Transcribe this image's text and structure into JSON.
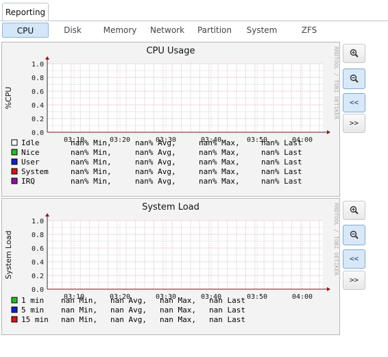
{
  "main_tab": "Reporting",
  "subtabs": [
    {
      "label": "CPU",
      "active": true
    },
    {
      "label": "Disk",
      "active": false
    },
    {
      "label": "Memory",
      "active": false
    },
    {
      "label": "Network",
      "active": false
    },
    {
      "label": "Partition",
      "active": false
    },
    {
      "label": "System",
      "active": false
    },
    {
      "label": "ZFS",
      "active": false
    }
  ],
  "watermark": "RRDTOOL / TOBI OETIKER",
  "buttons": {
    "zoom_in": "zoom-in",
    "zoom_out": "zoom-out",
    "back": "<<",
    "forward": ">>"
  },
  "graphs": [
    {
      "title": "CPU Usage",
      "ylabel": "%CPU",
      "y_ticks": [
        "1.0",
        "0.8",
        "0.6",
        "0.4",
        "0.2",
        "0.0"
      ],
      "x_ticks": [
        "03:10",
        "03:20",
        "03:30",
        "03:40",
        "03:50",
        "04:00"
      ],
      "legend": [
        {
          "name": "Idle",
          "color": "#ffffff",
          "min": "nan% Min,",
          "avg": "nan% Avg,",
          "max": "nan% Max,",
          "last": "nan% Last"
        },
        {
          "name": "Nice",
          "color": "#20c020",
          "min": "nan% Min,",
          "avg": "nan% Avg,",
          "max": "nan% Max,",
          "last": "nan% Last"
        },
        {
          "name": "User",
          "color": "#1020d0",
          "min": "nan% Min,",
          "avg": "nan% Avg,",
          "max": "nan% Max,",
          "last": "nan% Last"
        },
        {
          "name": "System",
          "color": "#e01010",
          "min": "nan% Min,",
          "avg": "nan% Avg,",
          "max": "nan% Max,",
          "last": "nan% Last"
        },
        {
          "name": "IRQ",
          "color": "#9010a0",
          "min": "nan% Min,",
          "avg": "nan% Avg,",
          "max": "nan% Max,",
          "last": "nan% Last"
        }
      ]
    },
    {
      "title": "System Load",
      "ylabel": "System Load",
      "y_ticks": [
        "1.0",
        "0.8",
        "0.6",
        "0.4",
        "0.2",
        "0.0"
      ],
      "x_ticks": [
        "03:10",
        "03:20",
        "03:30",
        "03:40",
        "03:50",
        "04:00"
      ],
      "legend": [
        {
          "name": " 1 min",
          "color": "#20c020",
          "min": "nan Min,",
          "avg": "nan Avg,",
          "max": "nan Max,",
          "last": "nan Last"
        },
        {
          "name": " 5 min",
          "color": "#1020d0",
          "min": "nan Min,",
          "avg": "nan Avg,",
          "max": "nan Max,",
          "last": "nan Last"
        },
        {
          "name": "15 min",
          "color": "#e01010",
          "min": "nan Min,",
          "avg": "nan Avg,",
          "max": "nan Max,",
          "last": "nan Last"
        }
      ]
    }
  ],
  "chart_data": [
    {
      "type": "line",
      "title": "CPU Usage",
      "ylabel": "%CPU",
      "xlabel": "",
      "ylim": [
        0,
        1.0
      ],
      "x": [
        "03:10",
        "03:20",
        "03:30",
        "03:40",
        "03:50",
        "04:00"
      ],
      "series": [
        {
          "name": "Idle",
          "values": []
        },
        {
          "name": "Nice",
          "values": []
        },
        {
          "name": "User",
          "values": []
        },
        {
          "name": "System",
          "values": []
        },
        {
          "name": "IRQ",
          "values": []
        }
      ],
      "grid": true
    },
    {
      "type": "line",
      "title": "System Load",
      "ylabel": "System Load",
      "xlabel": "",
      "ylim": [
        0,
        1.0
      ],
      "x": [
        "03:10",
        "03:20",
        "03:30",
        "03:40",
        "03:50",
        "04:00"
      ],
      "series": [
        {
          "name": "1 min",
          "values": []
        },
        {
          "name": "5 min",
          "values": []
        },
        {
          "name": "15 min",
          "values": []
        }
      ],
      "grid": true
    }
  ]
}
